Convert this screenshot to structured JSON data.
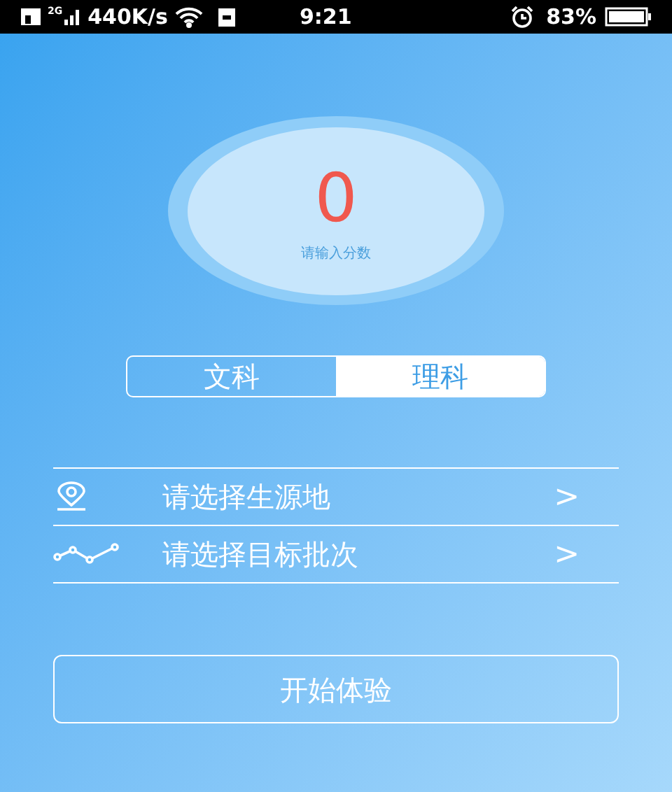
{
  "status_bar": {
    "network": "2G",
    "speed": "440K/s",
    "time": "9:21",
    "battery": "83%"
  },
  "score": {
    "value": "0",
    "hint": "请输入分数"
  },
  "tabs": [
    {
      "label": "文科",
      "selected": false
    },
    {
      "label": "理科",
      "selected": true
    }
  ],
  "rows": [
    {
      "kind": "location",
      "label": "请选择生源地",
      "arrow": ">"
    },
    {
      "kind": "batch",
      "label": "请选择目标批次",
      "arrow": ">"
    }
  ],
  "start_button": "开始体验"
}
